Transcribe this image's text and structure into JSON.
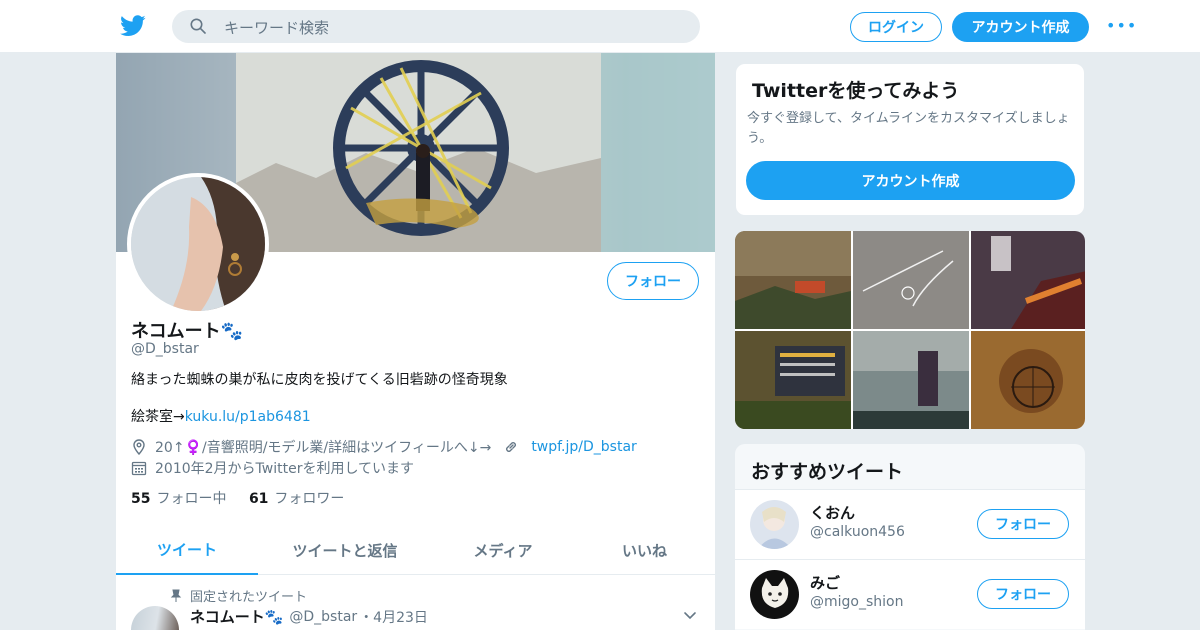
{
  "header": {
    "search_placeholder": "キーワード検索",
    "login_label": "ログイン",
    "signup_label": "アカウント作成",
    "more_label": "•••"
  },
  "profile": {
    "name": "ネコムート🐾",
    "handle": "@D_bstar",
    "bio": "絡まった蜘蛛の巣が私に皮肉を投げてくる旧砦跡の怪奇現象",
    "bio_link_prefix": "絵茶室→",
    "bio_link": "kuku.lu/p1ab6481",
    "location": "20↑♀️/音響照明/モデル業/詳細はツイフィールへ↓→",
    "website": "twpf.jp/D_bstar",
    "joined": "2010年2月からTwitterを利用しています",
    "following_count": "55",
    "following_label": "フォロー中",
    "followers_count": "61",
    "followers_label": "フォロワー",
    "follow_label": "フォロー"
  },
  "tabs": [
    {
      "label": "ツイート",
      "active": true
    },
    {
      "label": "ツイートと返信",
      "active": false
    },
    {
      "label": "メディア",
      "active": false
    },
    {
      "label": "いいね",
      "active": false
    }
  ],
  "pinned_tweet": {
    "pinned_label": "固定されたツイート",
    "author_name": "ネコムート🐾",
    "author_handle": "@D_bstar",
    "date": "・4月23日"
  },
  "signup_card": {
    "title": "Twitterを使ってみよう",
    "description": "今すぐ登録して、タイムラインをカスタマイズしましょう。",
    "button_label": "アカウント作成"
  },
  "recommended": {
    "title": "おすすめツイート",
    "users": [
      {
        "name": "くおん",
        "handle": "@calkuon456",
        "follow_label": "フォロー"
      },
      {
        "name": "みご",
        "handle": "@migo_shion",
        "follow_label": "フォロー"
      }
    ]
  },
  "colors": {
    "accent": "#1da1f2",
    "link": "#1b95e0",
    "muted": "#657786",
    "background": "#e6ecf0"
  }
}
